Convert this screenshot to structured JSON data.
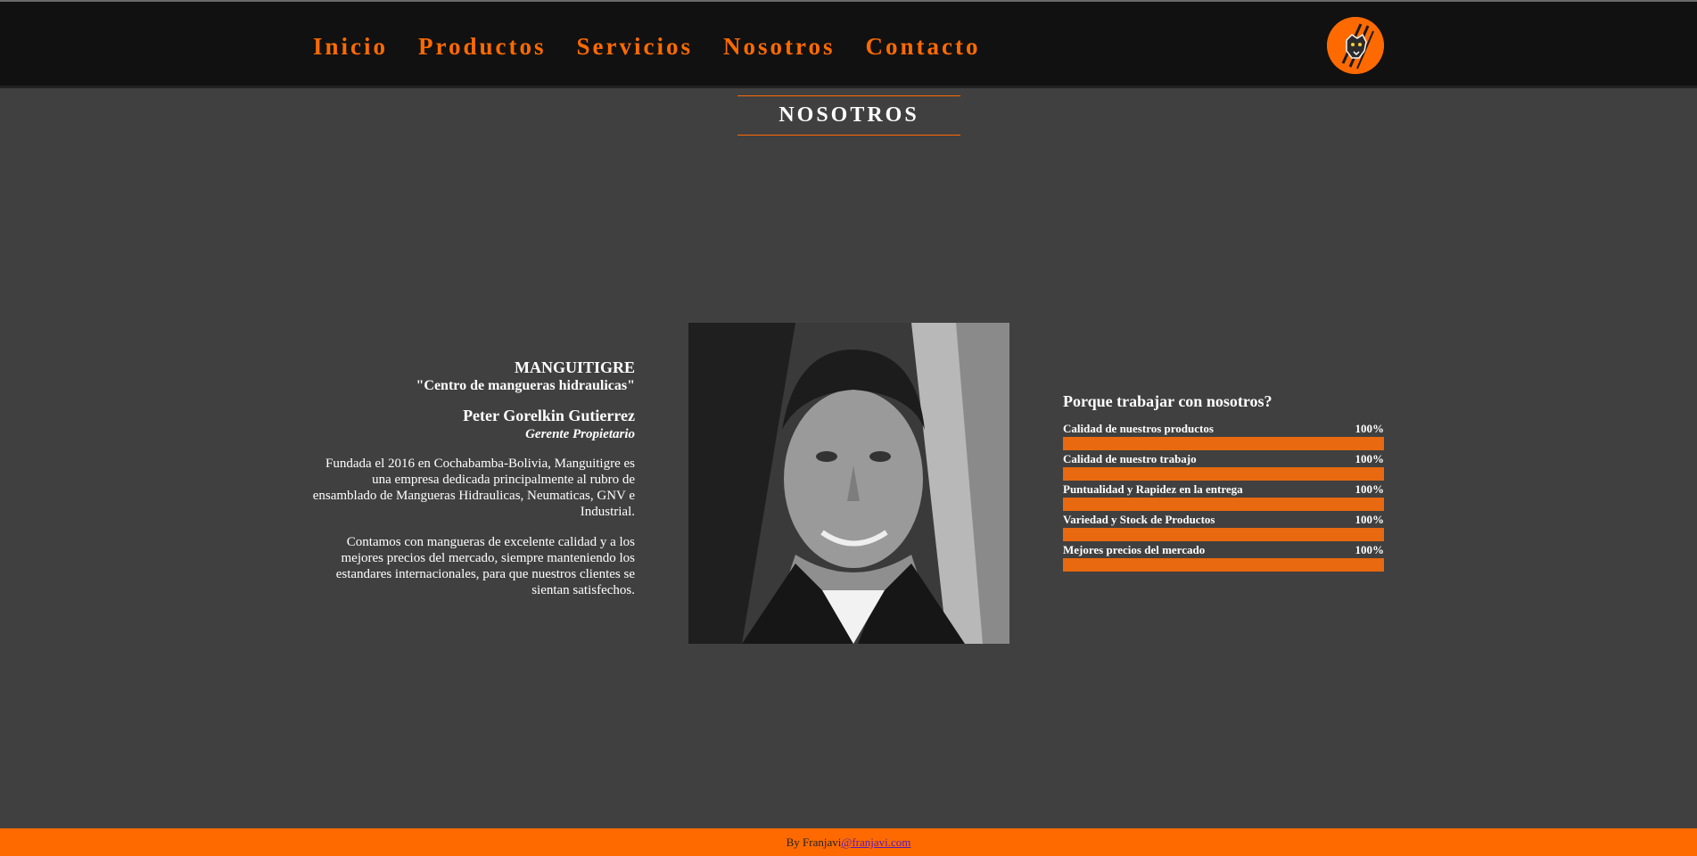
{
  "nav": {
    "items": [
      {
        "label": "Inicio"
      },
      {
        "label": "Productos"
      },
      {
        "label": "Servicios"
      },
      {
        "label": "Nosotros"
      },
      {
        "label": "Contacto"
      }
    ]
  },
  "section_title": "NOSOTROS",
  "about": {
    "company_name": "MANGUITIGRE",
    "tagline": "\"Centro de mangueras hidraulicas\"",
    "owner_name": "Peter Gorelkin Gutierrez",
    "owner_role": "Gerente Propietario",
    "paragraph1": "Fundada el 2016 en Cochabamba-Bolivia, Manguitigre es una empresa dedicada principalmente al rubro de ensamblado de Mangueras Hidraulicas, Neumaticas, GNV e Industrial.",
    "paragraph2": "Contamos con mangueras de excelente calidad y a los mejores precios del mercado, siempre manteniendo los estandares internacionales, para que nuestros clientes se sientan satisfechos."
  },
  "why": {
    "title": "Porque trabajar con nosotros?",
    "skills": [
      {
        "label": "Calidad de nuestros productos",
        "percent_text": "100%",
        "value": 100
      },
      {
        "label": "Calidad de nuestro trabajo",
        "percent_text": "100%",
        "value": 100
      },
      {
        "label": "Puntualidad y Rapidez en la entrega",
        "percent_text": "100%",
        "value": 100
      },
      {
        "label": "Variedad y Stock de Productos",
        "percent_text": "100%",
        "value": 100
      },
      {
        "label": "Mejores precios del mercado",
        "percent_text": "100%",
        "value": 100
      }
    ]
  },
  "footer": {
    "prefix": "By Franjavi",
    "link": "@franjavi.com"
  },
  "colors": {
    "accent": "#ff6a00",
    "background": "#404040",
    "navbar": "#111111",
    "bar_fill": "#e8690f"
  },
  "icons": {
    "logo": "tiger-logo-icon"
  }
}
